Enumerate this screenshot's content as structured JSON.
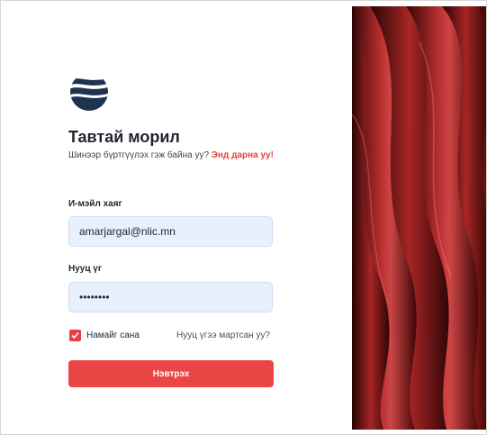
{
  "login": {
    "title": "Тавтай морил",
    "subtitle": "Шинээр бүртгүүлэх гэж байна уу?",
    "register_link": "Энд дарна уу!",
    "email_label": "И-мэйл хаяг",
    "email_value": "amarjargal@nlic.mn",
    "password_label": "Нууц үг",
    "password_value": "12345678",
    "remember_label": "Намайг сана",
    "remember_checked": true,
    "forgot_link": "Нууц үгээ мартсан уу?",
    "submit_label": "Нэвтрэх"
  },
  "icons": {
    "logo": "waves-logo-icon",
    "checkbox": "checkmark-icon"
  },
  "colors": {
    "accent": "#ea4646",
    "input_bg": "#e9f0fd",
    "logo": "#1f3350",
    "text": "#1f2430"
  }
}
